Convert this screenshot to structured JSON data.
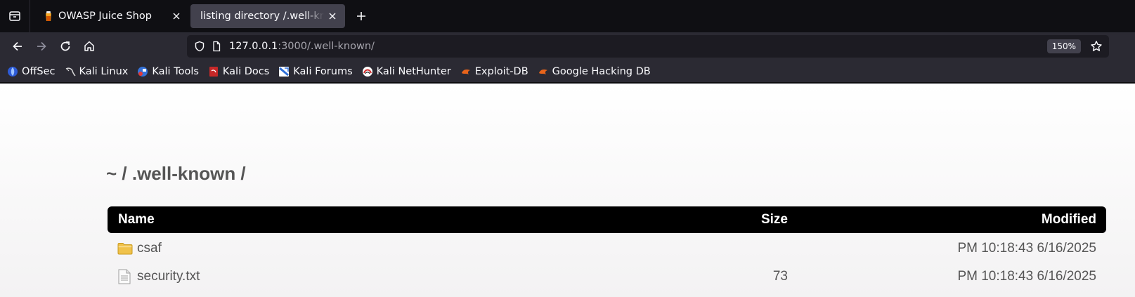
{
  "browser": {
    "tabs": [
      {
        "title": "OWASP Juice Shop",
        "favicon": "juice-shop-icon",
        "active": false
      },
      {
        "title": "listing directory /.well-known/",
        "favicon": "none",
        "active": true
      }
    ],
    "url": {
      "host": "127.0.0.1",
      "rest": ":3000/.well-known/"
    },
    "zoom": "150%",
    "bookmarks": [
      {
        "label": "OffSec",
        "icon": "offsec-icon"
      },
      {
        "label": "Kali Linux",
        "icon": "kali-dragon-icon"
      },
      {
        "label": "Kali Tools",
        "icon": "kali-tools-icon"
      },
      {
        "label": "Kali Docs",
        "icon": "kali-docs-icon"
      },
      {
        "label": "Kali Forums",
        "icon": "kali-forums-icon"
      },
      {
        "label": "Kali NetHunter",
        "icon": "kali-nethunter-icon"
      },
      {
        "label": "Exploit-DB",
        "icon": "exploit-db-icon"
      },
      {
        "label": "Google Hacking DB",
        "icon": "ghdb-icon"
      }
    ]
  },
  "page": {
    "heading": "~ / .well-known /",
    "columns": {
      "name": "Name",
      "size": "Size",
      "modified": "Modified"
    },
    "rows": [
      {
        "type": "folder",
        "icon": "folder-icon",
        "name": "csaf",
        "size": "",
        "modified": "PM 10:18:43 6/16/2025"
      },
      {
        "type": "file",
        "icon": "text-file-icon",
        "name": "security.txt",
        "size": "73",
        "modified": "PM 10:18:43 6/16/2025"
      }
    ]
  },
  "colors": {
    "tabstrip": "#0f0f13",
    "toolbar": "#2b2a33",
    "urlbar": "#1c1b22",
    "active_tab": "#42414d",
    "table_header": "#000000",
    "listing_text": "#555555"
  }
}
